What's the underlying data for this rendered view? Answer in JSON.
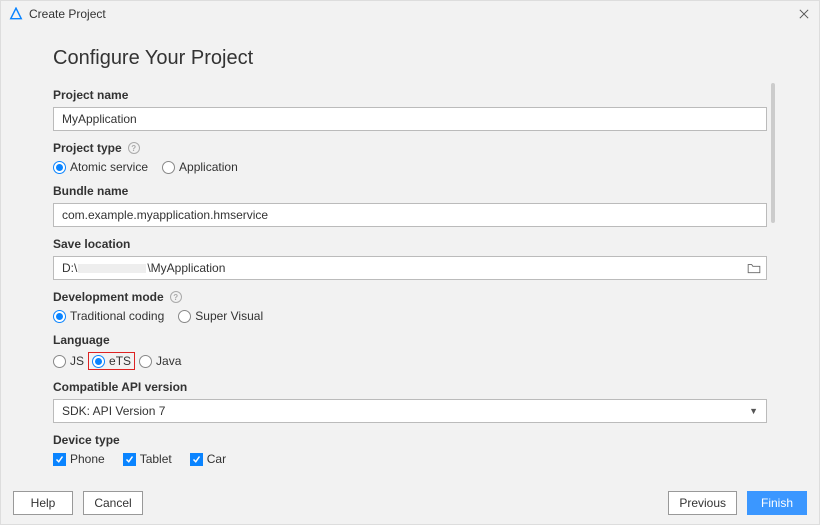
{
  "window": {
    "title": "Create Project"
  },
  "page": {
    "heading": "Configure Your Project"
  },
  "projectName": {
    "label": "Project name",
    "value": "MyApplication"
  },
  "projectType": {
    "label": "Project type",
    "options": {
      "atomic": "Atomic service",
      "application": "Application"
    },
    "selected": "atomic"
  },
  "bundleName": {
    "label": "Bundle name",
    "value": "com.example.myapplication.hmservice"
  },
  "saveLocation": {
    "label": "Save location",
    "prefix": "D:\\",
    "suffix": "\\MyApplication"
  },
  "devMode": {
    "label": "Development mode",
    "options": {
      "traditional": "Traditional coding",
      "superVisual": "Super Visual"
    },
    "selected": "traditional"
  },
  "language": {
    "label": "Language",
    "options": {
      "js": "JS",
      "ets": "eTS",
      "java": "Java"
    },
    "selected": "ets"
  },
  "apiVersion": {
    "label": "Compatible API version",
    "selected": "SDK: API Version 7"
  },
  "deviceType": {
    "label": "Device type",
    "options": {
      "phone": "Phone",
      "tablet": "Tablet",
      "car": "Car"
    },
    "checked": [
      "phone",
      "tablet",
      "car"
    ]
  },
  "footer": {
    "help": "Help",
    "cancel": "Cancel",
    "previous": "Previous",
    "finish": "Finish"
  }
}
